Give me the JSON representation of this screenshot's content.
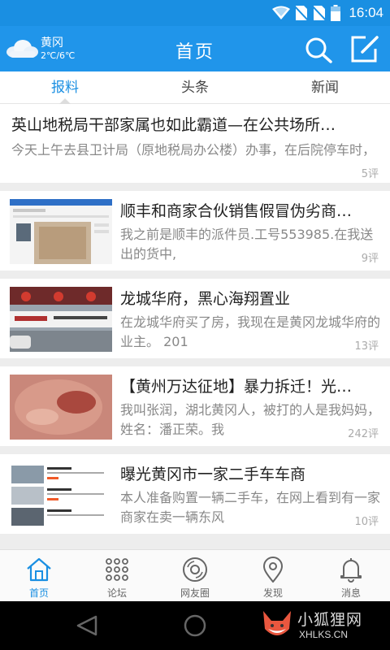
{
  "status_bar": {
    "time": "16:04"
  },
  "app_bar": {
    "weather": {
      "city": "黄冈",
      "temp": "2℃/6℃",
      "icon": "cloud-icon"
    },
    "title": "首页",
    "search_icon": "search-icon",
    "edit_icon": "edit-icon"
  },
  "tabs": [
    {
      "label": "报料",
      "active": true
    },
    {
      "label": "头条",
      "active": false
    },
    {
      "label": "新闻",
      "active": false
    }
  ],
  "feed": [
    {
      "headline": "英山地税局干部家属也如此霸道—在公共场所…",
      "summary": "今天上午去县卫计局（原地税局办公楼）办事，在后院停车时，",
      "comments": "5评"
    },
    {
      "headline": "顺丰和商家合伙销售假冒伪劣商…",
      "summary": "我之前是顺丰的派件员.工号553985.在我送出的货中,",
      "comments": "9评"
    },
    {
      "headline": "龙城华府，黑心海翔置业",
      "summary": "在龙城华府买了房，我现在是黄冈龙城华府的业主。 201",
      "comments": "13评"
    },
    {
      "headline": "【黄州万达征地】暴力拆迁！光…",
      "summary": "我叫张润，湖北黄冈人，被打的人是我妈妈，姓名：潘正荣。我",
      "comments": "242评"
    },
    {
      "headline": "曝光黄冈市一家二手车车商",
      "summary": "本人准备购置一辆二手车，在网上看到有一家商家在卖一辆东风",
      "comments": "10评"
    }
  ],
  "bottom_nav": [
    {
      "label": "首页",
      "icon": "home-icon",
      "active": true
    },
    {
      "label": "论坛",
      "icon": "grid-icon",
      "active": false
    },
    {
      "label": "网友圈",
      "icon": "disc-icon",
      "active": false
    },
    {
      "label": "发现",
      "icon": "location-pin-icon",
      "active": false
    },
    {
      "label": "消息",
      "icon": "bell-icon",
      "active": false
    }
  ],
  "watermark": {
    "text": "小狐狸网",
    "url": "XHLKS.CN"
  },
  "colors": {
    "primary": "#2095ea",
    "status_bar": "#1a8fe2",
    "text_muted": "#888888"
  }
}
